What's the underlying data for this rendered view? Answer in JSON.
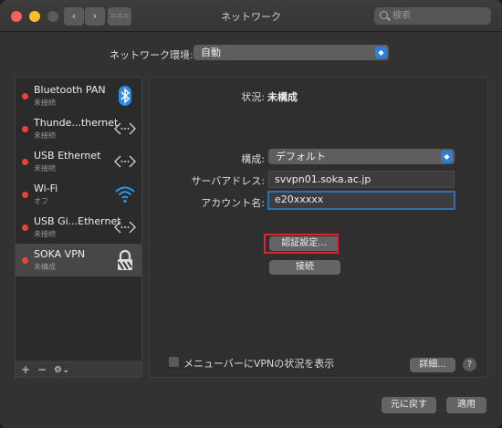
{
  "window": {
    "title": "ネットワーク",
    "search_placeholder": "検索"
  },
  "toolbar": {
    "back": "‹",
    "forward": "›",
    "grid": "⁙⁙⁙"
  },
  "location": {
    "label": "ネットワーク環境:",
    "value": "自動"
  },
  "services": [
    {
      "name": "Bluetooth PAN",
      "status": "未接続",
      "icon": "bluetooth-icon"
    },
    {
      "name": "Thunde...thernet",
      "status": "未接続",
      "icon": "ethernet-icon"
    },
    {
      "name": "USB Ethernet",
      "status": "未接続",
      "icon": "ethernet-icon"
    },
    {
      "name": "Wi-Fi",
      "status": "オフ",
      "icon": "wifi-icon"
    },
    {
      "name": "USB Gi...Ethernet",
      "status": "未接続",
      "icon": "ethernet-icon"
    },
    {
      "name": "SOKA VPN",
      "status": "未構成",
      "icon": "lock-icon"
    }
  ],
  "sidebar_tools": {
    "add": "+",
    "remove": "−",
    "gear": "⚙︎⌄"
  },
  "detail": {
    "status_label": "状況:",
    "status_value": "未構成",
    "config_label": "構成:",
    "config_value": "デフォルト",
    "server_label": "サーバアドレス:",
    "server_value": "svvpn01.soka.ac.jp",
    "account_label": "アカウント名:",
    "account_value": "e20xxxxx",
    "auth_button": "認証設定...",
    "connect_button": "接続",
    "menubar_checkbox": "メニューバーにVPNの状況を表示",
    "advanced_button": "詳細...",
    "help_button": "?"
  },
  "footer": {
    "revert": "元に戻す",
    "apply": "適用"
  },
  "colors": {
    "accent": "#2a7de1",
    "status_red": "#e8433e",
    "highlight": "#e0232a",
    "bluetooth": "#2a8cf0",
    "wifi": "#2e9cf5"
  }
}
